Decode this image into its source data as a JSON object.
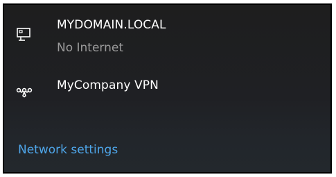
{
  "networks": [
    {
      "icon": "ethernet-monitor-icon",
      "name": "MYDOMAIN.LOCAL",
      "status": "No Internet"
    },
    {
      "icon": "vpn-icon",
      "name": "MyCompany VPN"
    }
  ],
  "footer": {
    "settings_link": "Network settings"
  },
  "colors": {
    "background": "#1f2024",
    "text": "#ffffff",
    "status_text": "#9a9a9a",
    "link": "#4ea6ea"
  }
}
